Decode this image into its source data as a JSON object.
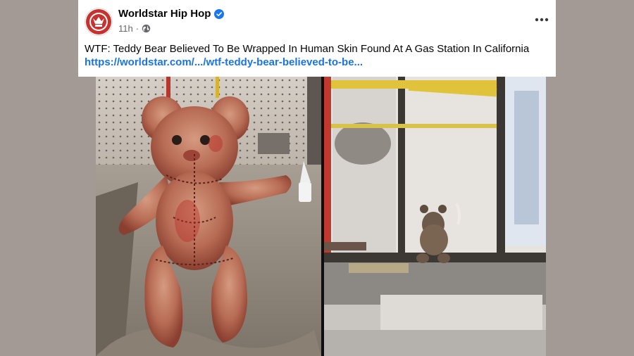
{
  "post": {
    "page_name": "Worldstar Hip Hop",
    "verified": true,
    "time": "11h",
    "separator": "·",
    "audience_icon": "globe-icon",
    "more_icon": "more-options-icon",
    "caption": "WTF: Teddy Bear Believed To Be Wrapped In Human Skin Found At A Gas Station In California",
    "link_text": "https://worldstar.com/.../wtf-teddy-bear-believed-to-be..."
  },
  "colors": {
    "background": "#a39a95",
    "link": "#1b74e4",
    "verified": "#1877f2",
    "avatar_brand": "#c8312e"
  }
}
